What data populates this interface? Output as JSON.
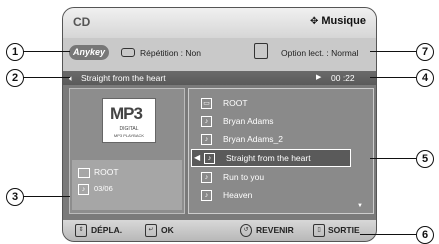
{
  "header": {
    "title": "CD",
    "mode": "Musique",
    "mode_icon": "note-icon"
  },
  "info": {
    "anykey_label": "Anykey",
    "repeat_text": "Répétition : Non",
    "read_option_text": "Option lect. : Normal"
  },
  "track": {
    "title": "Straight from the heart",
    "time": "00 :22"
  },
  "left_panel": {
    "logo_main": "MP3",
    "logo_digital": "DIGITAL",
    "logo_playback": "MP3 PLAYBACK",
    "folder": "ROOT",
    "count": "03/06"
  },
  "list": {
    "items": [
      {
        "label": "ROOT",
        "icon": "folder-icon"
      },
      {
        "label": "Bryan Adams",
        "icon": "note-icon"
      },
      {
        "label": "Bryan Adams_2",
        "icon": "note-icon"
      },
      {
        "label": "Straight from the heart",
        "icon": "note-icon",
        "selected": true
      },
      {
        "label": "Run to you",
        "icon": "note-icon"
      },
      {
        "label": "Heaven",
        "icon": "note-icon"
      }
    ]
  },
  "footer": {
    "move": "DÉPLA.",
    "ok": "OK",
    "back": "REVENIR",
    "exit": "SORTIE"
  },
  "callouts": {
    "c1": "1",
    "c2": "2",
    "c3": "3",
    "c4": "4",
    "c5": "5",
    "c6": "6",
    "c7": "7"
  }
}
